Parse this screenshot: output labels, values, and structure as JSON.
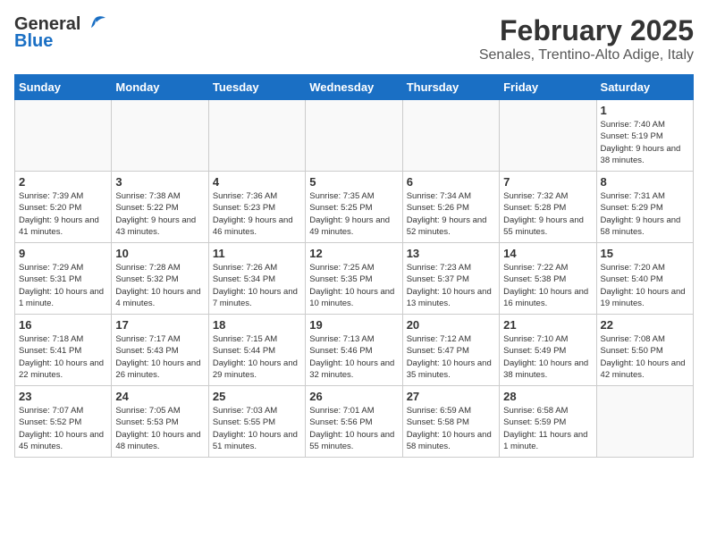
{
  "logo": {
    "general": "General",
    "blue": "Blue"
  },
  "title": {
    "month_year": "February 2025",
    "location": "Senales, Trentino-Alto Adige, Italy"
  },
  "calendar": {
    "headers": [
      "Sunday",
      "Monday",
      "Tuesday",
      "Wednesday",
      "Thursday",
      "Friday",
      "Saturday"
    ],
    "rows": [
      [
        {
          "day": "",
          "detail": ""
        },
        {
          "day": "",
          "detail": ""
        },
        {
          "day": "",
          "detail": ""
        },
        {
          "day": "",
          "detail": ""
        },
        {
          "day": "",
          "detail": ""
        },
        {
          "day": "",
          "detail": ""
        },
        {
          "day": "1",
          "detail": "Sunrise: 7:40 AM\nSunset: 5:19 PM\nDaylight: 9 hours and 38 minutes."
        }
      ],
      [
        {
          "day": "2",
          "detail": "Sunrise: 7:39 AM\nSunset: 5:20 PM\nDaylight: 9 hours and 41 minutes."
        },
        {
          "day": "3",
          "detail": "Sunrise: 7:38 AM\nSunset: 5:22 PM\nDaylight: 9 hours and 43 minutes."
        },
        {
          "day": "4",
          "detail": "Sunrise: 7:36 AM\nSunset: 5:23 PM\nDaylight: 9 hours and 46 minutes."
        },
        {
          "day": "5",
          "detail": "Sunrise: 7:35 AM\nSunset: 5:25 PM\nDaylight: 9 hours and 49 minutes."
        },
        {
          "day": "6",
          "detail": "Sunrise: 7:34 AM\nSunset: 5:26 PM\nDaylight: 9 hours and 52 minutes."
        },
        {
          "day": "7",
          "detail": "Sunrise: 7:32 AM\nSunset: 5:28 PM\nDaylight: 9 hours and 55 minutes."
        },
        {
          "day": "8",
          "detail": "Sunrise: 7:31 AM\nSunset: 5:29 PM\nDaylight: 9 hours and 58 minutes."
        }
      ],
      [
        {
          "day": "9",
          "detail": "Sunrise: 7:29 AM\nSunset: 5:31 PM\nDaylight: 10 hours and 1 minute."
        },
        {
          "day": "10",
          "detail": "Sunrise: 7:28 AM\nSunset: 5:32 PM\nDaylight: 10 hours and 4 minutes."
        },
        {
          "day": "11",
          "detail": "Sunrise: 7:26 AM\nSunset: 5:34 PM\nDaylight: 10 hours and 7 minutes."
        },
        {
          "day": "12",
          "detail": "Sunrise: 7:25 AM\nSunset: 5:35 PM\nDaylight: 10 hours and 10 minutes."
        },
        {
          "day": "13",
          "detail": "Sunrise: 7:23 AM\nSunset: 5:37 PM\nDaylight: 10 hours and 13 minutes."
        },
        {
          "day": "14",
          "detail": "Sunrise: 7:22 AM\nSunset: 5:38 PM\nDaylight: 10 hours and 16 minutes."
        },
        {
          "day": "15",
          "detail": "Sunrise: 7:20 AM\nSunset: 5:40 PM\nDaylight: 10 hours and 19 minutes."
        }
      ],
      [
        {
          "day": "16",
          "detail": "Sunrise: 7:18 AM\nSunset: 5:41 PM\nDaylight: 10 hours and 22 minutes."
        },
        {
          "day": "17",
          "detail": "Sunrise: 7:17 AM\nSunset: 5:43 PM\nDaylight: 10 hours and 26 minutes."
        },
        {
          "day": "18",
          "detail": "Sunrise: 7:15 AM\nSunset: 5:44 PM\nDaylight: 10 hours and 29 minutes."
        },
        {
          "day": "19",
          "detail": "Sunrise: 7:13 AM\nSunset: 5:46 PM\nDaylight: 10 hours and 32 minutes."
        },
        {
          "day": "20",
          "detail": "Sunrise: 7:12 AM\nSunset: 5:47 PM\nDaylight: 10 hours and 35 minutes."
        },
        {
          "day": "21",
          "detail": "Sunrise: 7:10 AM\nSunset: 5:49 PM\nDaylight: 10 hours and 38 minutes."
        },
        {
          "day": "22",
          "detail": "Sunrise: 7:08 AM\nSunset: 5:50 PM\nDaylight: 10 hours and 42 minutes."
        }
      ],
      [
        {
          "day": "23",
          "detail": "Sunrise: 7:07 AM\nSunset: 5:52 PM\nDaylight: 10 hours and 45 minutes."
        },
        {
          "day": "24",
          "detail": "Sunrise: 7:05 AM\nSunset: 5:53 PM\nDaylight: 10 hours and 48 minutes."
        },
        {
          "day": "25",
          "detail": "Sunrise: 7:03 AM\nSunset: 5:55 PM\nDaylight: 10 hours and 51 minutes."
        },
        {
          "day": "26",
          "detail": "Sunrise: 7:01 AM\nSunset: 5:56 PM\nDaylight: 10 hours and 55 minutes."
        },
        {
          "day": "27",
          "detail": "Sunrise: 6:59 AM\nSunset: 5:58 PM\nDaylight: 10 hours and 58 minutes."
        },
        {
          "day": "28",
          "detail": "Sunrise: 6:58 AM\nSunset: 5:59 PM\nDaylight: 11 hours and 1 minute."
        },
        {
          "day": "",
          "detail": ""
        }
      ]
    ]
  }
}
